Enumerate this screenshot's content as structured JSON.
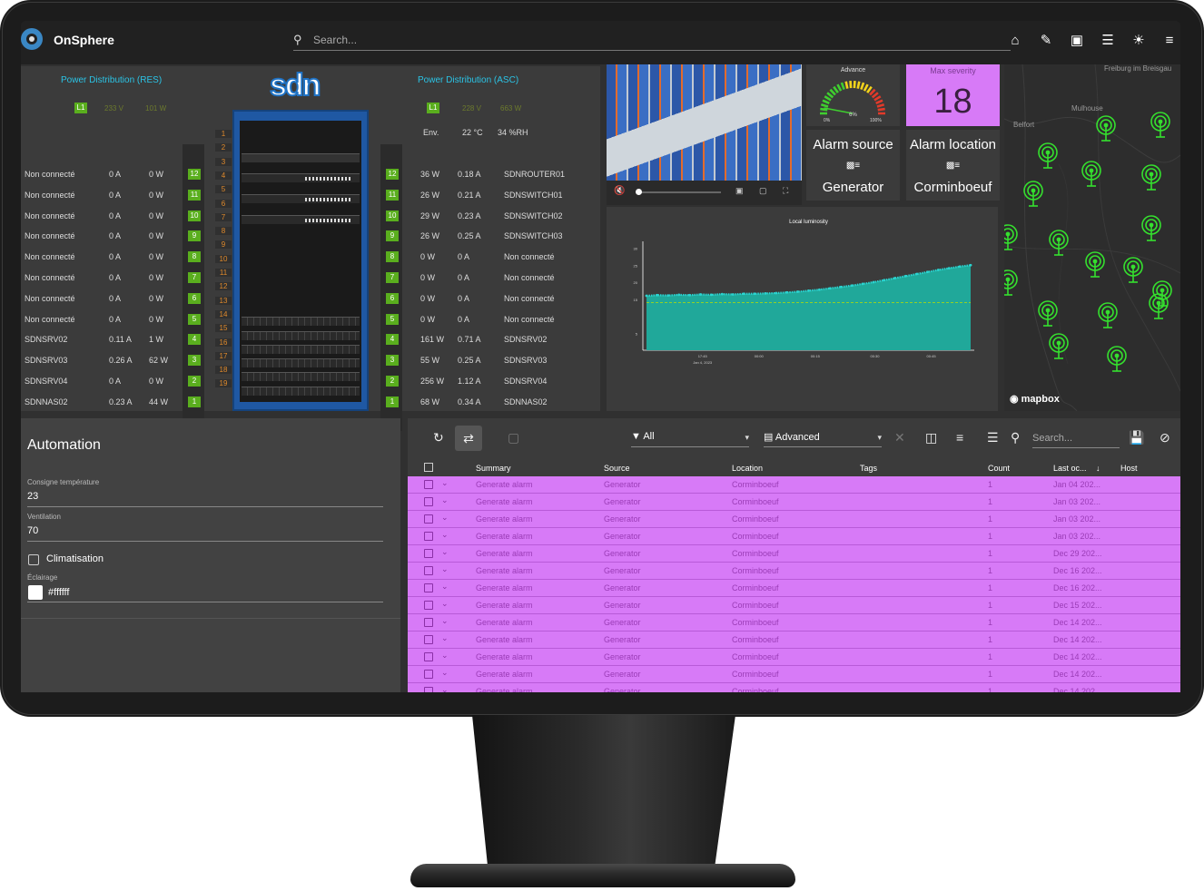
{
  "app": {
    "name": "OnSphere",
    "search_placeholder": "Search..."
  },
  "topbar_icons": [
    "home-icon",
    "edit-icon",
    "screen-icon",
    "list-icon",
    "brightness-icon",
    "menu-icon"
  ],
  "rack": {
    "left_title": "Power Distribution (RES)",
    "right_title": "Power Distribution (ASC)",
    "left_l1": "L1",
    "left_l1_v": "233 V",
    "left_l1_w": "101 W",
    "right_l1": "L1",
    "right_l1_v": "228 V",
    "right_l1_w": "663 W",
    "env_label": "Env.",
    "env_temp": "22 °C",
    "env_hum": "34 %RH",
    "rack_logo": "sdn",
    "left_rows": [
      {
        "name": "Non connecté",
        "a": "0 A",
        "w": "0 W",
        "port": "12"
      },
      {
        "name": "Non connecté",
        "a": "0 A",
        "w": "0 W",
        "port": "11"
      },
      {
        "name": "Non connecté",
        "a": "0 A",
        "w": "0 W",
        "port": "10"
      },
      {
        "name": "Non connecté",
        "a": "0 A",
        "w": "0 W",
        "port": "9"
      },
      {
        "name": "Non connecté",
        "a": "0 A",
        "w": "0 W",
        "port": "8"
      },
      {
        "name": "Non connecté",
        "a": "0 A",
        "w": "0 W",
        "port": "7"
      },
      {
        "name": "Non connecté",
        "a": "0 A",
        "w": "0 W",
        "port": "6"
      },
      {
        "name": "Non connecté",
        "a": "0 A",
        "w": "0 W",
        "port": "5"
      },
      {
        "name": "SDNSRV02",
        "a": "0.11 A",
        "w": "1 W",
        "port": "4"
      },
      {
        "name": "SDNSRV03",
        "a": "0.26 A",
        "w": "62 W",
        "port": "3"
      },
      {
        "name": "SDNSRV04",
        "a": "0 A",
        "w": "0 W",
        "port": "2"
      },
      {
        "name": "SDNNAS02",
        "a": "0.23 A",
        "w": "44 W",
        "port": "1"
      }
    ],
    "right_rows": [
      {
        "port": "12",
        "w": "36 W",
        "a": "0.18 A",
        "name": "SDNROUTER01"
      },
      {
        "port": "11",
        "w": "26 W",
        "a": "0.21 A",
        "name": "SDNSWITCH01"
      },
      {
        "port": "10",
        "w": "29 W",
        "a": "0.23 A",
        "name": "SDNSWITCH02"
      },
      {
        "port": "9",
        "w": "26 W",
        "a": "0.25 A",
        "name": "SDNSWITCH03"
      },
      {
        "port": "8",
        "w": "0 W",
        "a": "0 A",
        "name": "Non connecté"
      },
      {
        "port": "7",
        "w": "0 W",
        "a": "0 A",
        "name": "Non connecté"
      },
      {
        "port": "6",
        "w": "0 W",
        "a": "0 A",
        "name": "Non connecté"
      },
      {
        "port": "5",
        "w": "0 W",
        "a": "0 A",
        "name": "Non connecté"
      },
      {
        "port": "4",
        "w": "161 W",
        "a": "0.71 A",
        "name": "SDNSRV02"
      },
      {
        "port": "3",
        "w": "55 W",
        "a": "0.25 A",
        "name": "SDNSRV03"
      },
      {
        "port": "2",
        "w": "256 W",
        "a": "1.12 A",
        "name": "SDNSRV04"
      },
      {
        "port": "1",
        "w": "68 W",
        "a": "0.34 A",
        "name": "SDNNAS02"
      }
    ],
    "unit_numbers": [
      "1",
      "2",
      "3",
      "4",
      "5",
      "6",
      "7",
      "8",
      "9",
      "10",
      "11",
      "12",
      "13",
      "14",
      "15",
      "16",
      "17",
      "18",
      "19"
    ]
  },
  "gauge": {
    "title": "Advance",
    "value": "6%",
    "min_label": "0%",
    "max_label": "100%",
    "value_fraction": 0.06
  },
  "severity": {
    "label": "Max severity",
    "value": "18"
  },
  "alarm_source": {
    "label": "Alarm source",
    "value": "Generator"
  },
  "alarm_location": {
    "label": "Alarm location",
    "value": "Corminboeuf"
  },
  "chart_data": {
    "type": "area",
    "title": "Local luminosity",
    "xlabel": "",
    "ylabel": "",
    "x_ticks": [
      "17:45",
      "00:00",
      "00:15",
      "00:30",
      "00:45"
    ],
    "x_sub": "Jan 4, 2023",
    "y_ticks": [
      "30",
      "25",
      "20",
      "15",
      "5"
    ],
    "ylim": [
      0,
      32
    ],
    "threshold": 14,
    "values": [
      16,
      16.2,
      16.1,
      16.3,
      16.2,
      16.4,
      16.3,
      16.5,
      16.4,
      16.6,
      16.6,
      16.7,
      16.8,
      17.0,
      17.2,
      17.5,
      17.8,
      18.2,
      18.6,
      19.0,
      19.5,
      20,
      20.6,
      21.2,
      21.8,
      22.4,
      23.0,
      23.6,
      24.1,
      24.6,
      25.0
    ]
  },
  "map": {
    "cities": [
      "Freiburg im Breisgau",
      "Mulhouse",
      "Belfort"
    ],
    "attribution": "mapbox"
  },
  "automation": {
    "title": "Automation",
    "consigne_label": "Consigne température",
    "consigne_value": "23",
    "vent_label": "Ventilation",
    "vent_value": "70",
    "clim_label": "Climatisation",
    "eclairage_label": "Éclairage",
    "eclairage_value": "#ffffff"
  },
  "alarms": {
    "filter_value": "All",
    "mode_value": "Advanced",
    "search_placeholder": "Search...",
    "columns": [
      "Summary",
      "Source",
      "Location",
      "Tags",
      "Count",
      "Last oc...",
      "Host"
    ],
    "rows": [
      {
        "summary": "Generate alarm",
        "source": "Generator",
        "location": "Corminboeuf",
        "tags": "",
        "count": "1",
        "last": "Jan 04 202...",
        "host": ""
      },
      {
        "summary": "Generate alarm",
        "source": "Generator",
        "location": "Corminboeuf",
        "tags": "",
        "count": "1",
        "last": "Jan 03 202...",
        "host": ""
      },
      {
        "summary": "Generate alarm",
        "source": "Generator",
        "location": "Corminboeuf",
        "tags": "",
        "count": "1",
        "last": "Jan 03 202...",
        "host": ""
      },
      {
        "summary": "Generate alarm",
        "source": "Generator",
        "location": "Corminboeuf",
        "tags": "",
        "count": "1",
        "last": "Jan 03 202...",
        "host": ""
      },
      {
        "summary": "Generate alarm",
        "source": "Generator",
        "location": "Corminboeuf",
        "tags": "",
        "count": "1",
        "last": "Dec 29 202...",
        "host": ""
      },
      {
        "summary": "Generate alarm",
        "source": "Generator",
        "location": "Corminboeuf",
        "tags": "",
        "count": "1",
        "last": "Dec 16 202...",
        "host": ""
      },
      {
        "summary": "Generate alarm",
        "source": "Generator",
        "location": "Corminboeuf",
        "tags": "",
        "count": "1",
        "last": "Dec 16 202...",
        "host": ""
      },
      {
        "summary": "Generate alarm",
        "source": "Generator",
        "location": "Corminboeuf",
        "tags": "",
        "count": "1",
        "last": "Dec 15 202...",
        "host": ""
      },
      {
        "summary": "Generate alarm",
        "source": "Generator",
        "location": "Corminboeuf",
        "tags": "",
        "count": "1",
        "last": "Dec 14 202...",
        "host": ""
      },
      {
        "summary": "Generate alarm",
        "source": "Generator",
        "location": "Corminboeuf",
        "tags": "",
        "count": "1",
        "last": "Dec 14 202...",
        "host": ""
      },
      {
        "summary": "Generate alarm",
        "source": "Generator",
        "location": "Corminboeuf",
        "tags": "",
        "count": "1",
        "last": "Dec 14 202...",
        "host": ""
      },
      {
        "summary": "Generate alarm",
        "source": "Generator",
        "location": "Corminboeuf",
        "tags": "",
        "count": "1",
        "last": "Dec 14 202...",
        "host": ""
      },
      {
        "summary": "Generate alarm",
        "source": "Generator",
        "location": "Corminboeuf",
        "tags": "",
        "count": "1",
        "last": "Dec 14 202...",
        "host": ""
      }
    ]
  },
  "colors": {
    "severity_bg": "#d77af7",
    "accent": "#2bc4e6",
    "port_green": "#5aae1e",
    "chart_fill": "#20a89a",
    "chart_line": "#2ad4d0",
    "threshold": "#b8e000"
  }
}
